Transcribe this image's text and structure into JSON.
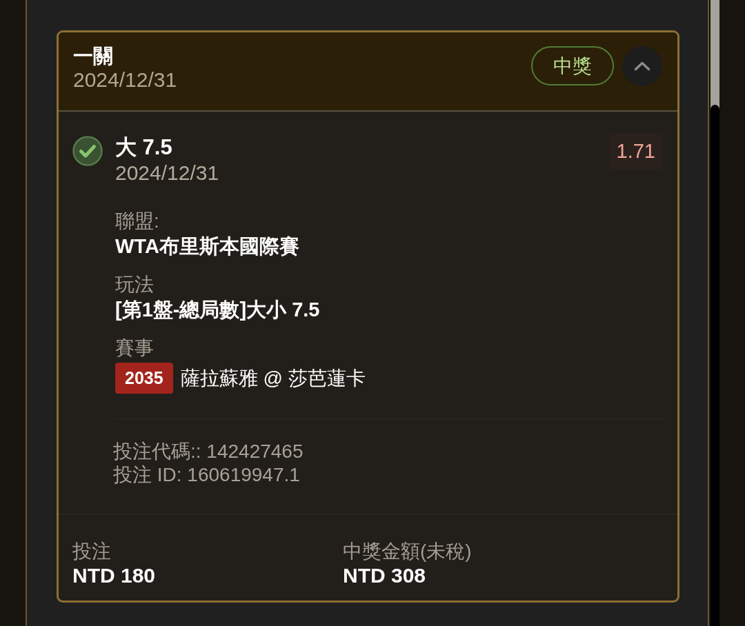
{
  "bet_card": {
    "title": "一關",
    "date": "2024/12/31",
    "status": {
      "label": "中獎",
      "kind": "won"
    },
    "expanded": true,
    "selection": {
      "won": true,
      "name": "大 7.5",
      "date": "2024/12/31",
      "odds": "1.71"
    },
    "details": [
      {
        "kind": "text",
        "label": "聯盟:",
        "value": "WTA布里斯本國際賽"
      },
      {
        "kind": "text",
        "label": "玩法",
        "value": "[第1盤-總局數]大小 7.5"
      },
      {
        "kind": "event",
        "label": "賽事",
        "event_number": "2035",
        "value": "薩拉蘇雅 @ 莎芭蓮卡"
      }
    ],
    "references": [
      "投注代碼:: 142427465",
      "投注 ID: 160619947.1"
    ],
    "totals": [
      {
        "label": "投注",
        "value": "NTD 180"
      },
      {
        "label": "中獎金額(未稅)",
        "value": "NTD 308"
      }
    ]
  }
}
